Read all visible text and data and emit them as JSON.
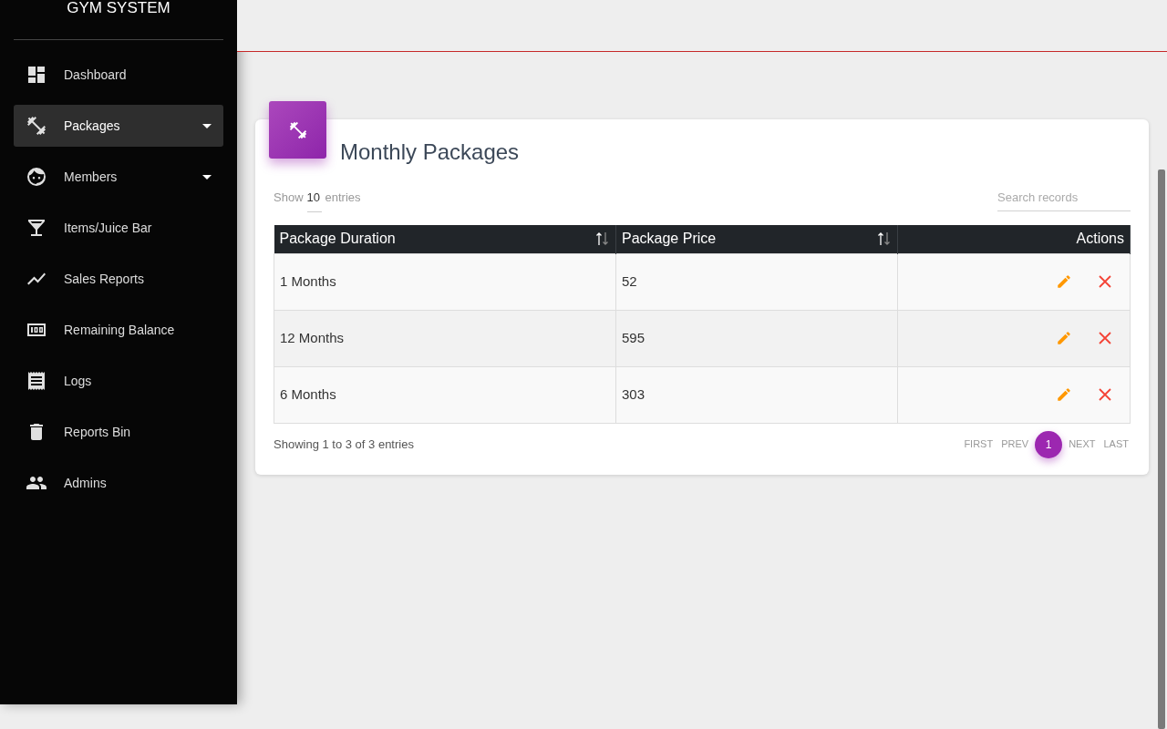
{
  "sidebar": {
    "title": "GYM SYSTEM",
    "items": [
      {
        "label": "Dashboard",
        "selected": false,
        "has_submenu": false
      },
      {
        "label": "Packages",
        "selected": true,
        "has_submenu": true
      },
      {
        "label": "Members",
        "selected": false,
        "has_submenu": true
      },
      {
        "label": "Items/Juice Bar",
        "selected": false,
        "has_submenu": false
      },
      {
        "label": "Sales Reports",
        "selected": false,
        "has_submenu": false
      },
      {
        "label": "Remaining Balance",
        "selected": false,
        "has_submenu": false
      },
      {
        "label": "Logs",
        "selected": false,
        "has_submenu": false
      },
      {
        "label": "Reports Bin",
        "selected": false,
        "has_submenu": false
      },
      {
        "label": "Admins",
        "selected": false,
        "has_submenu": false
      }
    ]
  },
  "card": {
    "title": "Monthly Packages",
    "length": {
      "prefix": "Show",
      "value": "10",
      "suffix": "entries"
    },
    "search": {
      "placeholder": "Search records"
    },
    "table": {
      "columns": [
        {
          "label": "Package Duration",
          "sortable": true
        },
        {
          "label": "Package Price",
          "sortable": true
        },
        {
          "label": "Actions",
          "sortable": false
        }
      ],
      "rows": [
        {
          "cells": [
            "1 Months",
            "52"
          ]
        },
        {
          "cells": [
            "12 Months",
            "595"
          ]
        },
        {
          "cells": [
            "6 Months",
            "303"
          ]
        }
      ]
    },
    "info": "Showing 1 to 3 of 3 entries",
    "pagination": [
      {
        "label": "FIRST",
        "selected": false
      },
      {
        "label": "PREV",
        "selected": false
      },
      {
        "label": "1",
        "selected": true
      },
      {
        "label": "NEXT",
        "selected": false
      },
      {
        "label": "LAST",
        "selected": false
      }
    ]
  }
}
